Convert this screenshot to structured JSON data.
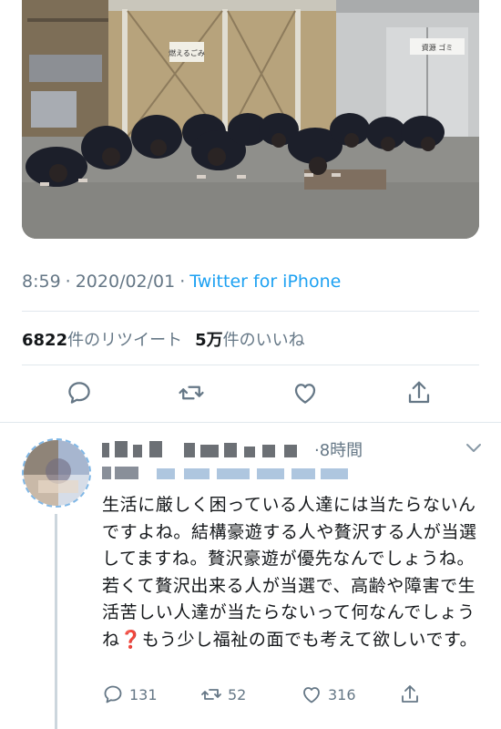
{
  "tweet": {
    "photo": {
      "sign_left": "燃えるごみ",
      "sign_right": "資源 ゴミ"
    },
    "time": "8:59",
    "separator": "·",
    "date": "2020/02/01",
    "source": "Twitter for iPhone",
    "retweets_count": "6822",
    "retweets_label": "件のリツイート",
    "likes_count": "5万",
    "likes_label": "件のいいね",
    "action_icons": [
      "reply-icon",
      "retweet-icon",
      "like-icon",
      "share-icon"
    ]
  },
  "reply": {
    "time": "·8時間",
    "text_lines": [
      "生活に厳しく困っている人達には当たらないんですよね。結構豪遊する人や贅沢する人が当選してますね。贅沢豪遊が優先なんでしょうね。若くて贅沢出来る人が当選で、高齢や障害で生活苦しい人達が当たらないって何なんでしょうね",
      "もう少し福祉の面でも考えて欲しいです。"
    ],
    "emoji": "❓",
    "replies": "131",
    "retweets": "52",
    "likes": "316"
  },
  "colors": {
    "link": "#1da1f2",
    "secondary_text": "#657786",
    "divider": "#e1e8ed",
    "emoji_red": "#e0245e"
  }
}
